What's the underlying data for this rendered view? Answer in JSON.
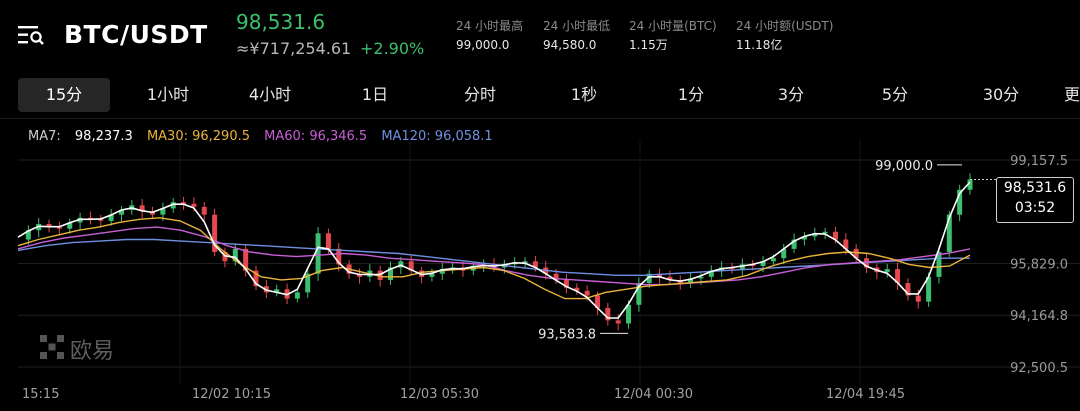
{
  "header": {
    "pair": "BTC/USDT",
    "last_price": "98,531.6",
    "cny_price": "≈¥717,254.61",
    "change": "+2.90%",
    "stats": [
      {
        "label": "24 小时最高",
        "value": "99,000.0"
      },
      {
        "label": "24 小时最低",
        "value": "94,580.0"
      },
      {
        "label": "24 小时量(BTC)",
        "value": "1.15万"
      },
      {
        "label": "24 小时额(USDT)",
        "value": "11.18亿"
      }
    ]
  },
  "tabs": [
    {
      "label": "15分",
      "active": true
    },
    {
      "label": "1小时"
    },
    {
      "label": "4小时"
    },
    {
      "label": "1日"
    },
    {
      "label": "分时"
    },
    {
      "label": "1秒"
    },
    {
      "label": "1分"
    },
    {
      "label": "3分"
    },
    {
      "label": "5分"
    },
    {
      "label": "30分"
    },
    {
      "label": "更"
    }
  ],
  "ma": [
    {
      "label": "MA7:",
      "value": "98,237.3",
      "color": "#ffffff"
    },
    {
      "label": "MA30:",
      "value": "96,290.5",
      "color": "#e9b43a"
    },
    {
      "label": "MA60:",
      "value": "96,346.5",
      "color": "#c85fd6"
    },
    {
      "label": "MA120:",
      "value": "96,058.1",
      "color": "#6f8fe0"
    }
  ],
  "watermark": "欧易",
  "colors": {
    "up": "#3cbf6e",
    "down": "#e5484d"
  },
  "chart_data": {
    "type": "line",
    "y_ticks": [
      "99,157.5",
      "95,829.0",
      "94,164.8",
      "92,500.5"
    ],
    "y_tick_values": [
      99157.5,
      95829.0,
      94164.8,
      92500.5
    ],
    "x_ticks": [
      "15:15",
      "12/02 10:15",
      "12/03 05:30",
      "12/04 00:30",
      "12/04 19:45"
    ],
    "ylim": [
      92500.5,
      99800
    ],
    "high_label": "99,000.0",
    "high_value": 99000.0,
    "low_label": "93,583.8",
    "low_value": 93583.8,
    "current_price": "98,531.6",
    "current_value": 98531.6,
    "countdown": "03:52",
    "price_series": [
      96600,
      96900,
      97100,
      97000,
      96950,
      97150,
      97300,
      97250,
      97200,
      97400,
      97550,
      97700,
      97500,
      97400,
      97600,
      97800,
      97750,
      97650,
      97400,
      96200,
      95900,
      96300,
      95600,
      95100,
      94900,
      95000,
      94700,
      94900,
      95500,
      96800,
      96300,
      95800,
      95500,
      95400,
      95600,
      95300,
      95700,
      95900,
      95600,
      95400,
      95500,
      95650,
      95700,
      95600,
      95750,
      95800,
      95700,
      95800,
      95850,
      95900,
      95700,
      95500,
      95300,
      95050,
      94950,
      94800,
      94400,
      94000,
      93900,
      94500,
      95200,
      95500,
      95400,
      95300,
      95200,
      95350,
      95400,
      95600,
      95700,
      95650,
      95800,
      95750,
      95900,
      96000,
      96300,
      96600,
      96700,
      96800,
      96850,
      96600,
      96300,
      96000,
      95700,
      95550,
      95650,
      95200,
      94800,
      94600,
      95400,
      96200,
      97400,
      98200,
      98531.6
    ],
    "series": [
      {
        "name": "MA30",
        "values": [
          96400,
          96600,
          96750,
          96900,
          97000,
          97150,
          97250,
          97300,
          97200,
          96900,
          96300,
          95800,
          95400,
          95300,
          95350,
          95600,
          95700,
          95550,
          95400,
          95400,
          95550,
          95600,
          95650,
          95700,
          95600,
          95350,
          95000,
          94700,
          94700,
          94900,
          95000,
          95100,
          95150,
          95200,
          95250,
          95300,
          95450,
          95700,
          95900,
          96050,
          96150,
          96200,
          96150,
          96000,
          95800,
          95700,
          95750,
          96100
        ]
      },
      {
        "name": "MA60",
        "values": [
          96300,
          96500,
          96650,
          96750,
          96850,
          96950,
          97000,
          96900,
          96700,
          96400,
          96200,
          96100,
          96050,
          96100,
          96150,
          96100,
          96000,
          95950,
          95900,
          95850,
          95800,
          95600,
          95450,
          95350,
          95300,
          95250,
          95200,
          95150,
          95150,
          95200,
          95250,
          95300,
          95400,
          95550,
          95700,
          95800,
          95850,
          95900,
          95950,
          96050,
          96150,
          96300
        ]
      },
      {
        "name": "MA120",
        "values": [
          96250,
          96400,
          96500,
          96550,
          96600,
          96600,
          96550,
          96500,
          96450,
          96400,
          96350,
          96300,
          96250,
          96200,
          96150,
          96050,
          95950,
          95850,
          95750,
          95650,
          95550,
          95500,
          95450,
          95450,
          95500,
          95550,
          95600,
          95650,
          95700,
          95750,
          95800,
          95850,
          95900,
          95950,
          96000,
          96000
        ]
      }
    ]
  }
}
